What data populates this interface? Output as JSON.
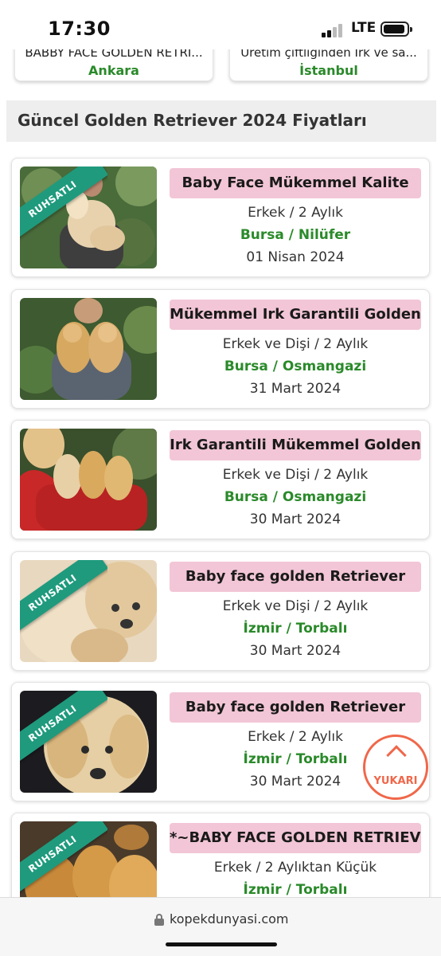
{
  "status_bar": {
    "time": "17:30",
    "network": "LTE"
  },
  "top_cards": [
    {
      "text": "BABBY FACE GOLDEN RETRI...",
      "city": "Ankara"
    },
    {
      "text": "Üretim çiftliğinden Irk ve sa...",
      "city": "İstanbul"
    }
  ],
  "section": {
    "title": "Güncel Golden Retriever 2024 Fiyatları"
  },
  "listings": [
    {
      "title": "Baby Face Mükemmel Kalite",
      "sex_age": "Erkek / 2 Aylık",
      "location": "Bursa / Nilüfer",
      "date": "01 Nisan 2024",
      "badge": "RUHSATLI"
    },
    {
      "title": "Mükemmel Irk Garantili Golden",
      "sex_age": "Erkek ve Dişi / 2 Aylık",
      "location": "Bursa / Osmangazi",
      "date": "31 Mart 2024"
    },
    {
      "title": "Irk Garantili Mükemmel Golden",
      "sex_age": "Erkek ve Dişi / 2 Aylık",
      "location": "Bursa / Osmangazi",
      "date": "30 Mart 2024"
    },
    {
      "title": "Baby face golden Retriever",
      "sex_age": "Erkek ve Dişi / 2 Aylık",
      "location": "İzmir / Torbalı",
      "date": "30 Mart 2024",
      "badge": "RUHSATLI"
    },
    {
      "title": "Baby face golden Retriever",
      "sex_age": "Erkek / 2 Aylık",
      "location": "İzmir / Torbalı",
      "date": "30 Mart 2024",
      "badge": "RUHSATLI"
    },
    {
      "title": "*~BABY FACE GOLDEN RETRIEVER",
      "sex_age": "Erkek / 2 Aylıktan Küçük",
      "location": "İzmir / Torbalı",
      "badge": "RUHSATLI"
    }
  ],
  "back_to_top": {
    "label": "YUKARI"
  },
  "url_bar": {
    "url": "kopekdunyasi.com"
  },
  "colors": {
    "title_bg": "#f2c6d6",
    "location": "#2a8a2a",
    "ribbon": "#1f9a7d",
    "accent": "#f0674a"
  }
}
